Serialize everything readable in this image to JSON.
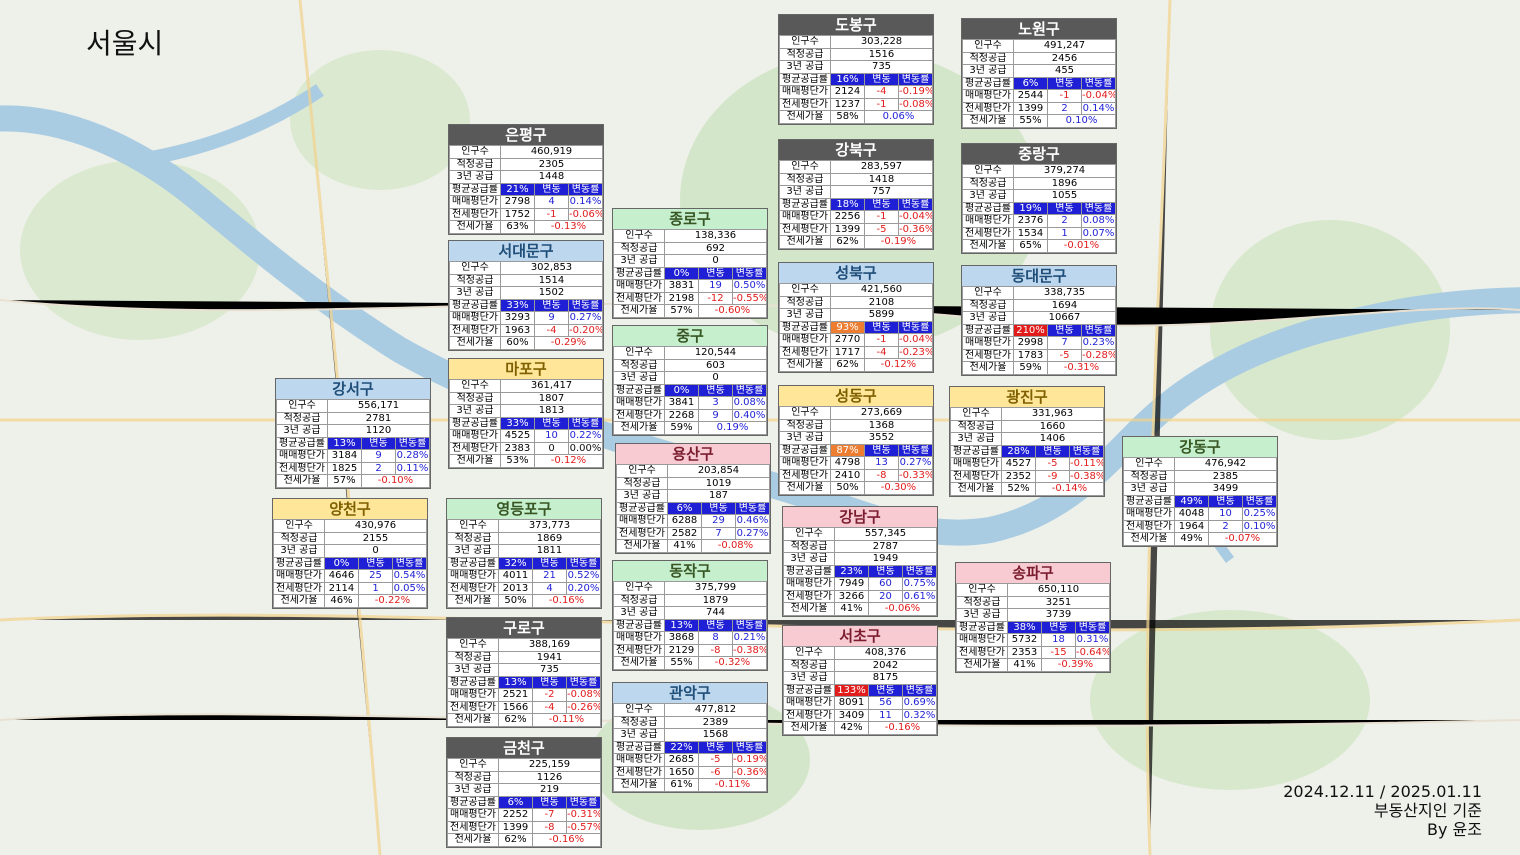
{
  "title": "서울시",
  "labels": {
    "population": "인구수",
    "proper_supply": "적정공급",
    "supply_3y": "3년 공급",
    "avg_supply_rate": "평균공급률",
    "change": "변동",
    "change_rate": "변동률",
    "sale_price": "매매평단가",
    "jeonse_price": "전세평단가",
    "jeonse_ratio": "전세가율"
  },
  "footer": {
    "period": "2024.12.11 / 2025.01.11",
    "source": "부동산지인 기준",
    "author": "By 윤조"
  },
  "colors": {
    "rate_blue": "#1f1fd6",
    "rate_orange": "#ed7d31",
    "rate_red": "#e21b1b",
    "river": "#a9cce3",
    "park": "#cfe3c6"
  },
  "districts": [
    {
      "name": "도봉구",
      "theme": "dark",
      "population": "303,228",
      "proper_supply": "1516",
      "supply_3y": "735",
      "rate": "16%",
      "rate_level": "hi",
      "sale": "2124",
      "sale_chg": "-4",
      "sale_rate": "-0.19%",
      "jeonse": "1237",
      "jeonse_chg": "-1",
      "jeonse_rate": "-0.08%",
      "ratio": "58%",
      "ratio_chg": "0.06%"
    },
    {
      "name": "노원구",
      "theme": "dark",
      "population": "491,247",
      "proper_supply": "2456",
      "supply_3y": "455",
      "rate": "6%",
      "rate_level": "hi",
      "sale": "2544",
      "sale_chg": "-1",
      "sale_rate": "-0.04%",
      "jeonse": "1399",
      "jeonse_chg": "2",
      "jeonse_rate": "0.14%",
      "ratio": "55%",
      "ratio_chg": "0.10%"
    },
    {
      "name": "은평구",
      "theme": "dark",
      "population": "460,919",
      "proper_supply": "2305",
      "supply_3y": "1448",
      "rate": "21%",
      "rate_level": "hi",
      "sale": "2798",
      "sale_chg": "4",
      "sale_rate": "0.14%",
      "jeonse": "1752",
      "jeonse_chg": "-1",
      "jeonse_rate": "-0.06%",
      "ratio": "63%",
      "ratio_chg": "-0.13%"
    },
    {
      "name": "강북구",
      "theme": "dark",
      "population": "283,597",
      "proper_supply": "1418",
      "supply_3y": "757",
      "rate": "18%",
      "rate_level": "hi",
      "sale": "2256",
      "sale_chg": "-1",
      "sale_rate": "-0.04%",
      "jeonse": "1399",
      "jeonse_chg": "-5",
      "jeonse_rate": "-0.36%",
      "ratio": "62%",
      "ratio_chg": "-0.19%"
    },
    {
      "name": "중랑구",
      "theme": "dark",
      "population": "379,274",
      "proper_supply": "1896",
      "supply_3y": "1055",
      "rate": "19%",
      "rate_level": "hi",
      "sale": "2376",
      "sale_chg": "2",
      "sale_rate": "0.08%",
      "jeonse": "1534",
      "jeonse_chg": "1",
      "jeonse_rate": "0.07%",
      "ratio": "65%",
      "ratio_chg": "-0.01%"
    },
    {
      "name": "종로구",
      "theme": "green",
      "population": "138,336",
      "proper_supply": "692",
      "supply_3y": "0",
      "rate": "0%",
      "rate_level": "hi",
      "sale": "3831",
      "sale_chg": "19",
      "sale_rate": "0.50%",
      "jeonse": "2198",
      "jeonse_chg": "-12",
      "jeonse_rate": "-0.55%",
      "ratio": "57%",
      "ratio_chg": "-0.60%"
    },
    {
      "name": "서대문구",
      "theme": "blue",
      "population": "302,853",
      "proper_supply": "1514",
      "supply_3y": "1502",
      "rate": "33%",
      "rate_level": "hi",
      "sale": "3293",
      "sale_chg": "9",
      "sale_rate": "0.27%",
      "jeonse": "1963",
      "jeonse_chg": "-4",
      "jeonse_rate": "-0.20%",
      "ratio": "60%",
      "ratio_chg": "-0.29%"
    },
    {
      "name": "성북구",
      "theme": "blue",
      "population": "421,560",
      "proper_supply": "2108",
      "supply_3y": "5899",
      "rate": "93%",
      "rate_level": "mid",
      "sale": "2770",
      "sale_chg": "-1",
      "sale_rate": "-0.04%",
      "jeonse": "1717",
      "jeonse_chg": "-4",
      "jeonse_rate": "-0.23%",
      "ratio": "62%",
      "ratio_chg": "-0.12%"
    },
    {
      "name": "동대문구",
      "theme": "blue",
      "population": "338,735",
      "proper_supply": "1694",
      "supply_3y": "10667",
      "rate": "210%",
      "rate_level": "max",
      "sale": "2998",
      "sale_chg": "7",
      "sale_rate": "0.23%",
      "jeonse": "1783",
      "jeonse_chg": "-5",
      "jeonse_rate": "-0.28%",
      "ratio": "59%",
      "ratio_chg": "-0.31%"
    },
    {
      "name": "중구",
      "theme": "green",
      "population": "120,544",
      "proper_supply": "603",
      "supply_3y": "0",
      "rate": "0%",
      "rate_level": "hi",
      "sale": "3841",
      "sale_chg": "3",
      "sale_rate": "0.08%",
      "jeonse": "2268",
      "jeonse_chg": "9",
      "jeonse_rate": "0.40%",
      "ratio": "59%",
      "ratio_chg": "0.19%"
    },
    {
      "name": "마포구",
      "theme": "yellow",
      "population": "361,417",
      "proper_supply": "1807",
      "supply_3y": "1813",
      "rate": "33%",
      "rate_level": "hi",
      "sale": "4525",
      "sale_chg": "10",
      "sale_rate": "0.22%",
      "jeonse": "2383",
      "jeonse_chg": "0",
      "jeonse_rate": "0.00%",
      "ratio": "53%",
      "ratio_chg": "-0.12%"
    },
    {
      "name": "강서구",
      "theme": "blue",
      "population": "556,171",
      "proper_supply": "2781",
      "supply_3y": "1120",
      "rate": "13%",
      "rate_level": "hi",
      "sale": "3184",
      "sale_chg": "9",
      "sale_rate": "0.28%",
      "jeonse": "1825",
      "jeonse_chg": "2",
      "jeonse_rate": "0.11%",
      "ratio": "57%",
      "ratio_chg": "-0.10%"
    },
    {
      "name": "성동구",
      "theme": "yellow",
      "population": "273,669",
      "proper_supply": "1368",
      "supply_3y": "3552",
      "rate": "87%",
      "rate_level": "mid",
      "sale": "4798",
      "sale_chg": "13",
      "sale_rate": "0.27%",
      "jeonse": "2410",
      "jeonse_chg": "-8",
      "jeonse_rate": "-0.33%",
      "ratio": "50%",
      "ratio_chg": "-0.30%"
    },
    {
      "name": "광진구",
      "theme": "yellow",
      "population": "331,963",
      "proper_supply": "1660",
      "supply_3y": "1406",
      "rate": "28%",
      "rate_level": "hi",
      "sale": "4527",
      "sale_chg": "-5",
      "sale_rate": "-0.11%",
      "jeonse": "2352",
      "jeonse_chg": "-9",
      "jeonse_rate": "-0.38%",
      "ratio": "52%",
      "ratio_chg": "-0.14%"
    },
    {
      "name": "용산구",
      "theme": "pink",
      "population": "203,854",
      "proper_supply": "1019",
      "supply_3y": "187",
      "rate": "6%",
      "rate_level": "hi",
      "sale": "6288",
      "sale_chg": "29",
      "sale_rate": "0.46%",
      "jeonse": "2582",
      "jeonse_chg": "7",
      "jeonse_rate": "0.27%",
      "ratio": "41%",
      "ratio_chg": "-0.08%"
    },
    {
      "name": "강동구",
      "theme": "green",
      "population": "476,942",
      "proper_supply": "2385",
      "supply_3y": "3499",
      "rate": "49%",
      "rate_level": "hi",
      "sale": "4048",
      "sale_chg": "10",
      "sale_rate": "0.25%",
      "jeonse": "1964",
      "jeonse_chg": "2",
      "jeonse_rate": "0.10%",
      "ratio": "49%",
      "ratio_chg": "-0.07%"
    },
    {
      "name": "양천구",
      "theme": "yellow",
      "population": "430,976",
      "proper_supply": "2155",
      "supply_3y": "0",
      "rate": "0%",
      "rate_level": "hi",
      "sale": "4646",
      "sale_chg": "25",
      "sale_rate": "0.54%",
      "jeonse": "2114",
      "jeonse_chg": "1",
      "jeonse_rate": "0.05%",
      "ratio": "46%",
      "ratio_chg": "-0.22%"
    },
    {
      "name": "영등포구",
      "theme": "green",
      "population": "373,773",
      "proper_supply": "1869",
      "supply_3y": "1811",
      "rate": "32%",
      "rate_level": "hi",
      "sale": "4011",
      "sale_chg": "21",
      "sale_rate": "0.52%",
      "jeonse": "2013",
      "jeonse_chg": "4",
      "jeonse_rate": "0.20%",
      "ratio": "50%",
      "ratio_chg": "-0.16%"
    },
    {
      "name": "강남구",
      "theme": "pink",
      "population": "557,345",
      "proper_supply": "2787",
      "supply_3y": "1949",
      "rate": "23%",
      "rate_level": "hi",
      "sale": "7949",
      "sale_chg": "60",
      "sale_rate": "0.75%",
      "jeonse": "3266",
      "jeonse_chg": "20",
      "jeonse_rate": "0.61%",
      "ratio": "41%",
      "ratio_chg": "-0.06%"
    },
    {
      "name": "동작구",
      "theme": "green",
      "population": "375,799",
      "proper_supply": "1879",
      "supply_3y": "744",
      "rate": "13%",
      "rate_level": "hi",
      "sale": "3868",
      "sale_chg": "8",
      "sale_rate": "0.21%",
      "jeonse": "2129",
      "jeonse_chg": "-8",
      "jeonse_rate": "-0.38%",
      "ratio": "55%",
      "ratio_chg": "-0.32%"
    },
    {
      "name": "송파구",
      "theme": "pink",
      "population": "650,110",
      "proper_supply": "3251",
      "supply_3y": "3739",
      "rate": "38%",
      "rate_level": "hi",
      "sale": "5732",
      "sale_chg": "18",
      "sale_rate": "0.31%",
      "jeonse": "2353",
      "jeonse_chg": "-15",
      "jeonse_rate": "-0.64%",
      "ratio": "41%",
      "ratio_chg": "-0.39%"
    },
    {
      "name": "구로구",
      "theme": "dark",
      "population": "388,169",
      "proper_supply": "1941",
      "supply_3y": "735",
      "rate": "13%",
      "rate_level": "hi",
      "sale": "2521",
      "sale_chg": "-2",
      "sale_rate": "-0.08%",
      "jeonse": "1566",
      "jeonse_chg": "-4",
      "jeonse_rate": "-0.26%",
      "ratio": "62%",
      "ratio_chg": "-0.11%"
    },
    {
      "name": "서초구",
      "theme": "pink",
      "population": "408,376",
      "proper_supply": "2042",
      "supply_3y": "8175",
      "rate": "133%",
      "rate_level": "max",
      "sale": "8091",
      "sale_chg": "56",
      "sale_rate": "0.69%",
      "jeonse": "3409",
      "jeonse_chg": "11",
      "jeonse_rate": "0.32%",
      "ratio": "42%",
      "ratio_chg": "-0.16%"
    },
    {
      "name": "관악구",
      "theme": "blue",
      "population": "477,812",
      "proper_supply": "2389",
      "supply_3y": "1568",
      "rate": "22%",
      "rate_level": "hi",
      "sale": "2685",
      "sale_chg": "-5",
      "sale_rate": "-0.19%",
      "jeonse": "1650",
      "jeonse_chg": "-6",
      "jeonse_rate": "-0.36%",
      "ratio": "61%",
      "ratio_chg": "-0.11%"
    },
    {
      "name": "금천구",
      "theme": "dark",
      "population": "225,159",
      "proper_supply": "1126",
      "supply_3y": "219",
      "rate": "6%",
      "rate_level": "hi",
      "sale": "2252",
      "sale_chg": "-7",
      "sale_rate": "-0.31%",
      "jeonse": "1399",
      "jeonse_chg": "-8",
      "jeonse_rate": "-0.57%",
      "ratio": "62%",
      "ratio_chg": "-0.16%"
    }
  ]
}
